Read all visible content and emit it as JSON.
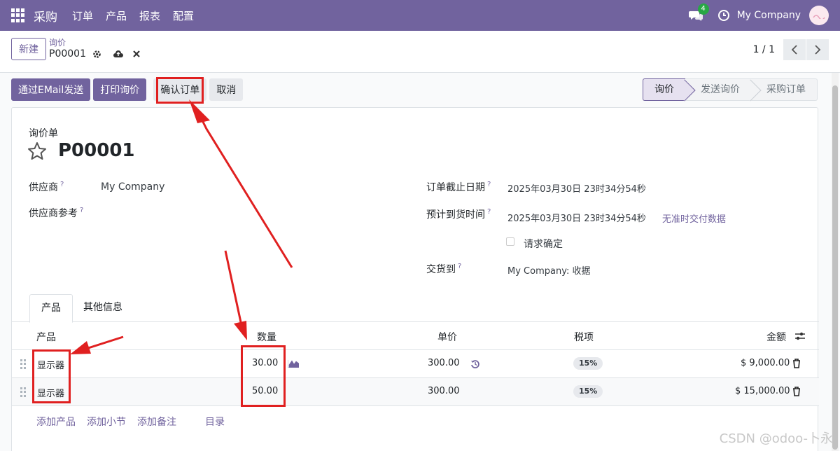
{
  "nav": {
    "brand": "采购",
    "menu": [
      "订单",
      "产品",
      "报表",
      "配置"
    ],
    "chat_badge": "4",
    "company": "My Company"
  },
  "control": {
    "new_label": "新建",
    "breadcrumb_parent": "询价",
    "breadcrumb_current": "P00001",
    "pager": "1 / 1"
  },
  "actions": {
    "send_email": "通过EMail发送",
    "print": "打印询价",
    "confirm": "确认订单",
    "cancel": "取消"
  },
  "status_steps": [
    "询价",
    "发送询价",
    "采购订单"
  ],
  "form": {
    "doc_type": "询价单",
    "doc_name": "P00001",
    "fields": {
      "vendor_label": "供应商",
      "vendor_value": "My Company",
      "vendor_ref_label": "供应商参考",
      "deadline_label": "订单截止日期",
      "deadline_value": "2025年03月30日 23时34分54秒",
      "expected_label": "预计到货时间",
      "expected_value": "2025年03月30日 23时34分54秒",
      "ontime_link": "无准时交付数据",
      "request_confirm": "请求确定",
      "deliver_label": "交货到",
      "deliver_value": "My Company: 收据"
    },
    "help_mark": "?"
  },
  "tabs": [
    "产品",
    "其他信息"
  ],
  "table": {
    "headers": {
      "product": "产品",
      "qty": "数量",
      "price": "单价",
      "tax": "税项",
      "amount": "金额"
    },
    "rows": [
      {
        "product": "显示器",
        "qty": "30.00",
        "price": "300.00",
        "tax": "15%",
        "amount": "$ 9,000.00"
      },
      {
        "product": "显示器",
        "qty": "50.00",
        "price": "300.00",
        "tax": "15%",
        "amount": "$ 15,000.00"
      }
    ],
    "add_links": [
      "添加产品",
      "添加小节",
      "添加备注",
      "目录"
    ]
  },
  "watermark": "CSDN @odoo-卜永",
  "colors": {
    "brand": "#71639e",
    "annotation": "#e02020"
  }
}
